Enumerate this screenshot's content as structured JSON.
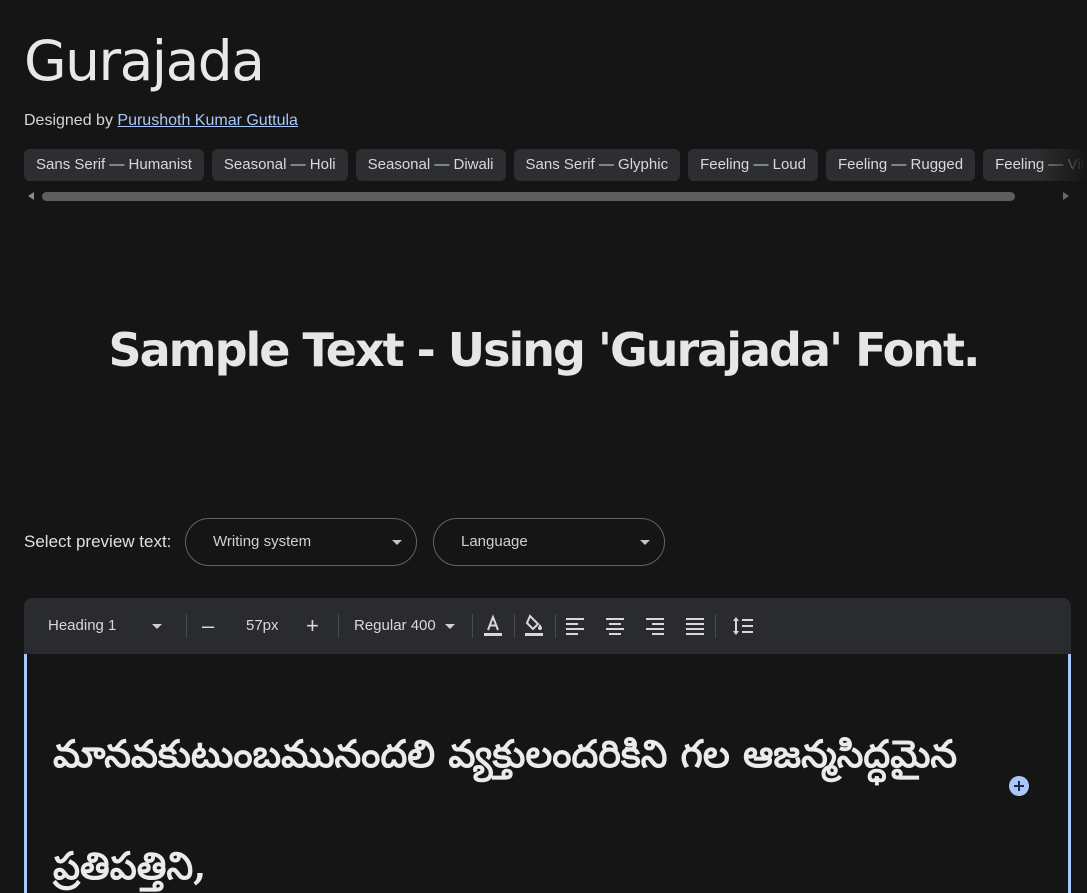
{
  "font": {
    "name": "Gurajada",
    "designed_by_label": "Designed by",
    "designer": "Purushoth Kumar Guttula"
  },
  "tags": [
    "Sans Serif — Humanist",
    "Seasonal — Holi",
    "Seasonal — Diwali",
    "Sans Serif — Glyphic",
    "Feeling — Loud",
    "Feeling — Rugged",
    "Feeling — Vintage"
  ],
  "sample_heading": "Sample Text - Using 'Gurajada' Font.",
  "preview": {
    "label": "Select preview text:",
    "writing_system": "Writing system",
    "language": "Language"
  },
  "toolbar": {
    "style": "Heading 1",
    "decrease": "–",
    "size": "57px",
    "increase": "+",
    "weight": "Regular 400"
  },
  "editor": {
    "text": "మానవకుటుంబమునందలి వ్యక్తులందరికిని గల ఆజన్మసిద్ధమైన ప్రతిపత్తిని,"
  },
  "icons": {
    "text_color": "text-color-icon",
    "highlight": "fill-color-icon",
    "align_left": "align-left-icon",
    "align_center": "align-center-icon",
    "align_right": "align-right-icon",
    "align_justify": "align-justify-icon",
    "line_height": "line-spacing-icon",
    "add": "add-circle-icon"
  },
  "colors": {
    "background": "#151515",
    "chip": "#2d2e31",
    "accent": "#a8c7fa",
    "toolbar": "#2a2b2e"
  }
}
